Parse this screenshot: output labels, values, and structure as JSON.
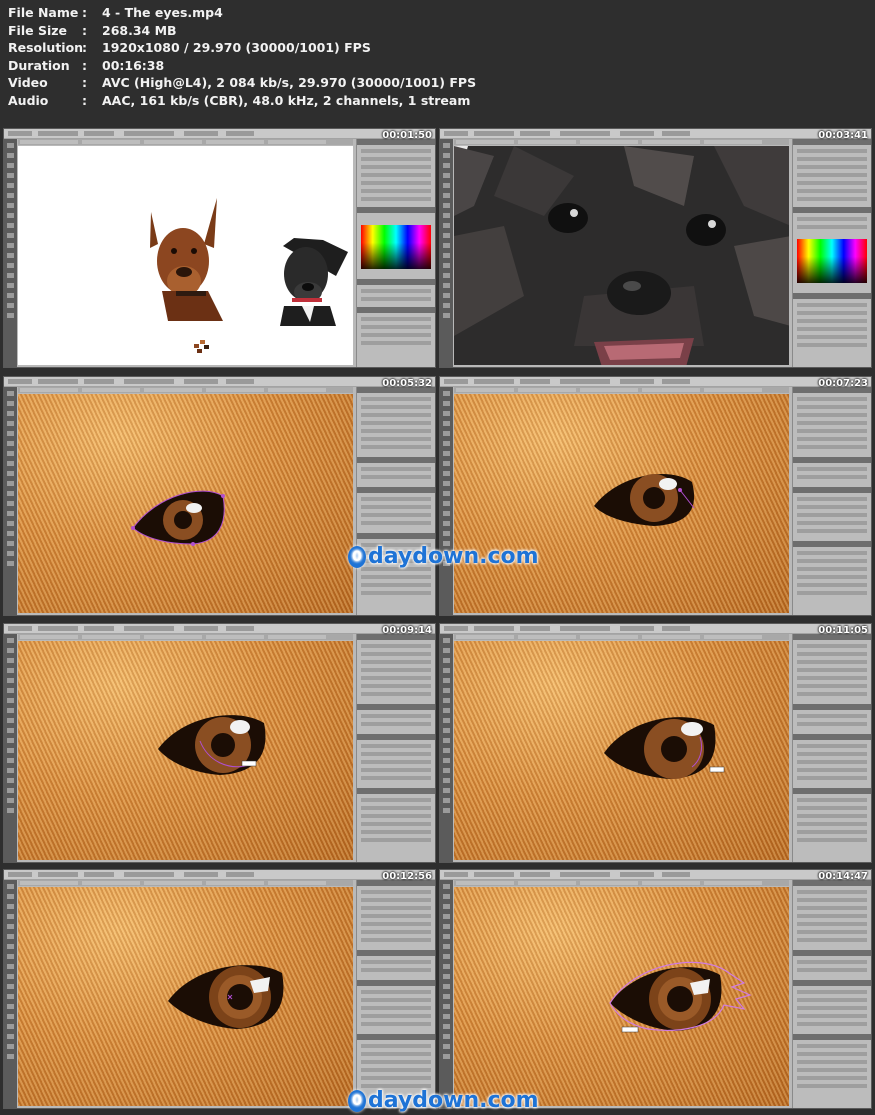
{
  "file_info": [
    {
      "key": "File Name",
      "sep": ":",
      "value": "4 - The eyes.mp4"
    },
    {
      "key": "File Size",
      "sep": ":",
      "value": "268.34 MB"
    },
    {
      "key": "Resolution",
      "sep": ":",
      "value": "1920x1080 / 29.970 (30000/1001) FPS"
    },
    {
      "key": "Duration",
      "sep": ":",
      "value": "00:16:38"
    },
    {
      "key": "Video",
      "sep": ":",
      "value": "AVC (High@L4), 2 084 kb/s, 29.970 (30000/1001) FPS"
    },
    {
      "key": "Audio",
      "sep": ":",
      "value": "AAC, 161 kb/s (CBR), 48.0 kHz, 2 channels, 1 stream"
    }
  ],
  "thumbnails": [
    {
      "timestamp": "00:01:50",
      "scene": "two-dogs-canvas"
    },
    {
      "timestamp": "00:03:41",
      "scene": "dark-dog-closeup"
    },
    {
      "timestamp": "00:05:32",
      "scene": "eye-path"
    },
    {
      "timestamp": "00:07:23",
      "scene": "eye-closeup"
    },
    {
      "timestamp": "00:09:14",
      "scene": "eye-iris-path"
    },
    {
      "timestamp": "00:11:05",
      "scene": "eye-iris"
    },
    {
      "timestamp": "00:12:56",
      "scene": "eye-vector"
    },
    {
      "timestamp": "00:14:47",
      "scene": "eye-outline-path"
    }
  ],
  "watermark": {
    "text": "daydown.com",
    "badge": "0"
  },
  "colors": {
    "background": "#2e2e2e",
    "text": "#f2f2f2",
    "watermark": "#1e73d6",
    "path": "#b04fd0"
  }
}
